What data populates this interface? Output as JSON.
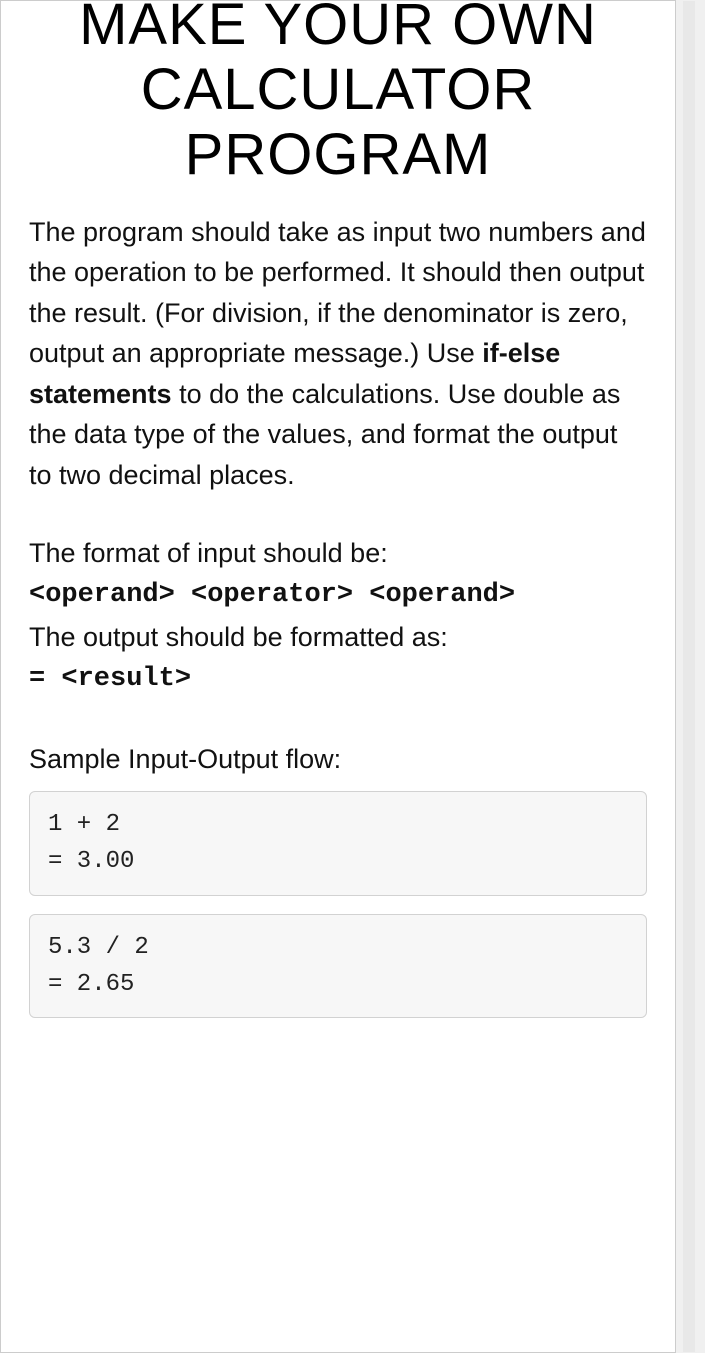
{
  "title": "MAKE YOUR OWN CALCULATOR PROGRAM",
  "para1_pre": "The program should take as input two numbers and the operation to be performed. It should then output the result. (For division, if the denominator is zero, output an appropriate message.) Use ",
  "para1_bold": "if-else statements",
  "para1_post": " to do the calculations. Use double as the data type of the values, and format the output to two decimal places.",
  "format": {
    "input_label": "The format of input should be:",
    "input_format": "<operand> <operator> <operand>",
    "output_label": "The output should be formatted as:",
    "output_format": "= <result>"
  },
  "sample_label": "Sample Input-Output flow:",
  "samples": [
    "1 + 2\n= 3.00",
    "5.3 / 2\n= 2.65"
  ]
}
